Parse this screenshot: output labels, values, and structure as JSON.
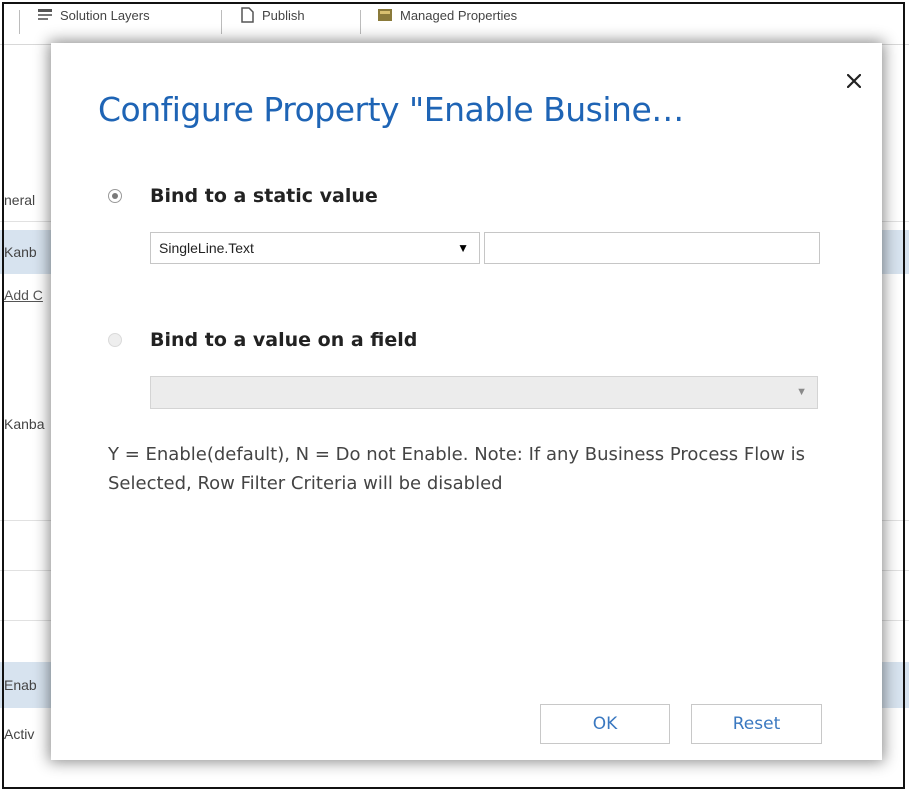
{
  "background": {
    "toolbar": {
      "items": [
        {
          "label": "Solution Layers",
          "icon": "layers-icon"
        },
        {
          "label": "Publish",
          "icon": "page-icon"
        },
        {
          "label": "Managed Properties",
          "icon": "properties-icon"
        }
      ]
    },
    "rows": [
      {
        "label": "neral"
      },
      {
        "label": "Kanb"
      },
      {
        "label": "Add C"
      },
      {
        "label": "Kanba"
      },
      {
        "label": "Enab"
      },
      {
        "label": "Activ"
      }
    ]
  },
  "dialog": {
    "title": "Configure Property \"Enable Busine…",
    "close_icon": "close-icon",
    "options": {
      "static": {
        "label": "Bind to a static value",
        "checked": true,
        "select_value": "SingleLine.Text",
        "text_value": ""
      },
      "field": {
        "label": "Bind to a value on a field",
        "checked": false,
        "select_value": ""
      }
    },
    "note": "Y = Enable(default), N = Do not Enable. Note: If any Business Process Flow is Selected, Row Filter Criteria will be disabled",
    "buttons": {
      "ok": "OK",
      "reset": "Reset"
    }
  },
  "colors": {
    "title": "#1e64b5",
    "button_text": "#3a78c0",
    "selected_row": "#d7e3ef"
  }
}
